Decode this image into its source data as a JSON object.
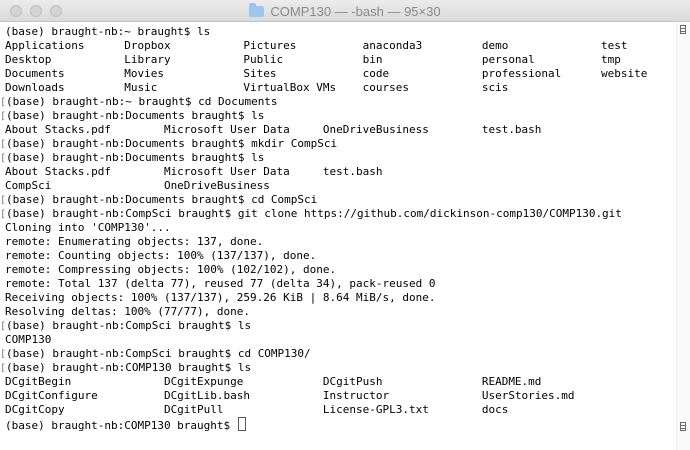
{
  "window": {
    "title": "COMP130 — -bash — 95×30",
    "icon": "folder-icon"
  },
  "terminal": {
    "lines": [
      {
        "mark": "",
        "text": "(base) braught-nb:~ braught$ ls"
      },
      {
        "mark": "",
        "text": "Applications      Dropbox           Pictures          anaconda3         demo              test"
      },
      {
        "mark": "",
        "text": "Desktop           Library           Public            bin               personal          tmp"
      },
      {
        "mark": "",
        "text": "Documents         Movies            Sites             code              professional      website"
      },
      {
        "mark": "",
        "text": "Downloads         Music             VirtualBox VMs    courses           scis"
      },
      {
        "mark": "[",
        "text": "(base) braught-nb:~ braught$ cd Documents"
      },
      {
        "mark": "[",
        "text": "(base) braught-nb:Documents braught$ ls"
      },
      {
        "mark": "",
        "text": "About Stacks.pdf        Microsoft User Data     OneDriveBusiness        test.bash"
      },
      {
        "mark": "[",
        "text": "(base) braught-nb:Documents braught$ mkdir CompSci"
      },
      {
        "mark": "[",
        "text": "(base) braught-nb:Documents braught$ ls"
      },
      {
        "mark": "",
        "text": "About Stacks.pdf        Microsoft User Data     test.bash"
      },
      {
        "mark": "",
        "text": "CompSci                 OneDriveBusiness"
      },
      {
        "mark": "[",
        "text": "(base) braught-nb:Documents braught$ cd CompSci"
      },
      {
        "mark": "[",
        "text": "(base) braught-nb:CompSci braught$ git clone https://github.com/dickinson-comp130/COMP130.git"
      },
      {
        "mark": "",
        "text": "Cloning into 'COMP130'..."
      },
      {
        "mark": "",
        "text": "remote: Enumerating objects: 137, done."
      },
      {
        "mark": "",
        "text": "remote: Counting objects: 100% (137/137), done."
      },
      {
        "mark": "",
        "text": "remote: Compressing objects: 100% (102/102), done."
      },
      {
        "mark": "",
        "text": "remote: Total 137 (delta 77), reused 77 (delta 34), pack-reused 0"
      },
      {
        "mark": "",
        "text": "Receiving objects: 100% (137/137), 259.26 KiB | 8.64 MiB/s, done."
      },
      {
        "mark": "",
        "text": "Resolving deltas: 100% (77/77), done."
      },
      {
        "mark": "[",
        "text": "(base) braught-nb:CompSci braught$ ls"
      },
      {
        "mark": "",
        "text": "COMP130"
      },
      {
        "mark": "[",
        "text": "(base) braught-nb:CompSci braught$ cd COMP130/"
      },
      {
        "mark": "[",
        "text": "(base) braught-nb:COMP130 braught$ ls"
      },
      {
        "mark": "",
        "text": "DCgitBegin              DCgitExpunge            DCgitPush               README.md"
      },
      {
        "mark": "",
        "text": "DCgitConfigure          DCgitLib.bash           Instructor              UserStories.md"
      },
      {
        "mark": "",
        "text": "DCgitCopy               DCgitPull               License-GPL3.txt        docs"
      }
    ],
    "prompt": "(base) braught-nb:COMP130 braught$ "
  }
}
